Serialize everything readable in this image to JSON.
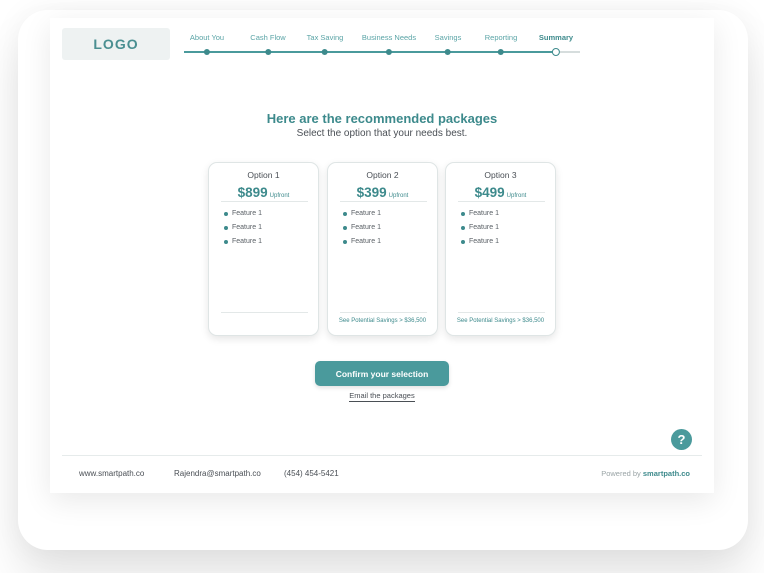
{
  "logo": "LOGO",
  "steps": [
    {
      "label": "About You",
      "state": "done"
    },
    {
      "label": "Cash Flow",
      "state": "done"
    },
    {
      "label": "Tax Saving",
      "state": "done"
    },
    {
      "label": "Business Needs",
      "state": "done"
    },
    {
      "label": "Savings",
      "state": "done"
    },
    {
      "label": "Reporting",
      "state": "done"
    },
    {
      "label": "Summary",
      "state": "current"
    }
  ],
  "heading": "Here are the recommended packages",
  "subheading": "Select the option that your needs best.",
  "options": [
    {
      "title": "Option 1",
      "price": "$899",
      "upfront": "Upfront",
      "features": [
        "Feature 1",
        "Feature 1",
        "Feature 1"
      ],
      "savings_link": ""
    },
    {
      "title": "Option 2",
      "price": "$399",
      "upfront": "Upfront",
      "features": [
        "Feature 1",
        "Feature 1",
        "Feature 1"
      ],
      "savings_link": "See Potential Savings > $36,500"
    },
    {
      "title": "Option 3",
      "price": "$499",
      "upfront": "Upfront",
      "features": [
        "Feature 1",
        "Feature 1",
        "Feature 1"
      ],
      "savings_link": "See Potential Savings > $36,500"
    }
  ],
  "confirm_label": "Confirm your selection",
  "email_label": "Email the packages",
  "help_label": "?",
  "footer": {
    "website": "www.smartpath.co",
    "email": "Rajendra@smartpath.co",
    "phone": "(454) 454-5421",
    "powered_prefix": "Powered by",
    "powered_brand": "smartpath.co"
  },
  "colors": {
    "accent": "#4a9a9c",
    "accent_dark": "#3d8a8c",
    "text": "#4a4f55"
  }
}
